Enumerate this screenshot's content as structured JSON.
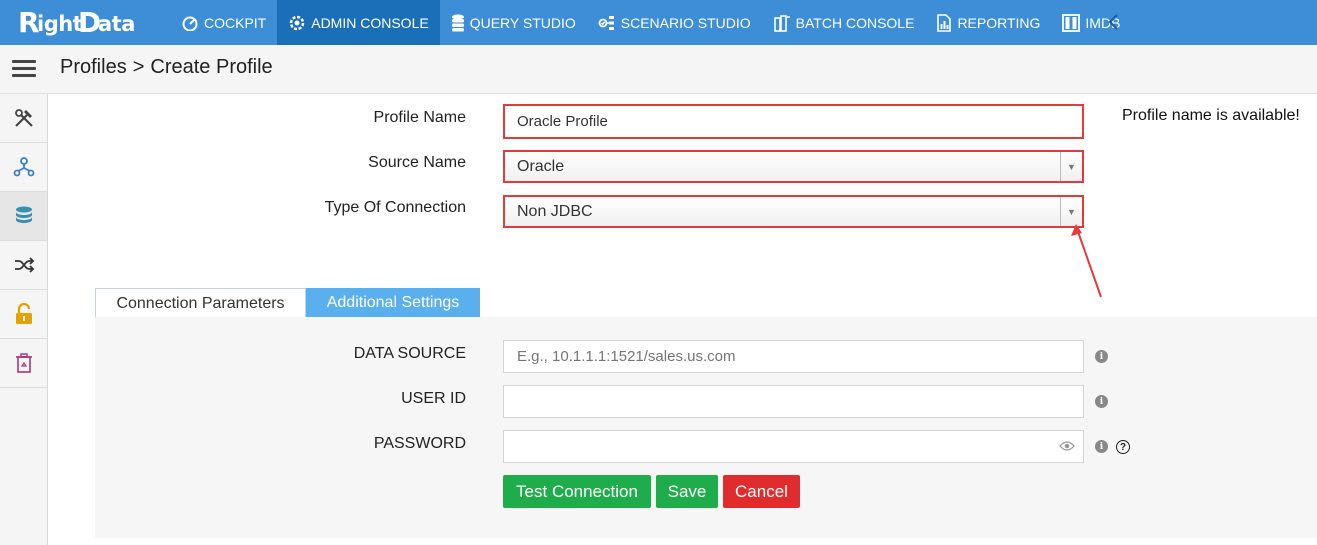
{
  "brand": {
    "logo_text": "RightData"
  },
  "nav": {
    "items": [
      {
        "label": "COCKPIT",
        "icon": "gauge-icon",
        "active": false
      },
      {
        "label": "ADMIN CONSOLE",
        "icon": "gear-icon",
        "active": true
      },
      {
        "label": "QUERY STUDIO",
        "icon": "database-icon",
        "active": false
      },
      {
        "label": "SCENARIO STUDIO",
        "icon": "flow-icon",
        "active": false
      },
      {
        "label": "BATCH CONSOLE",
        "icon": "batch-icon",
        "active": false
      },
      {
        "label": "REPORTING",
        "icon": "report-icon",
        "active": false
      },
      {
        "label": "IMDB",
        "icon": "columns-icon",
        "active": false
      }
    ]
  },
  "breadcrumb": {
    "parent": "Profiles",
    "separator": ">",
    "current": "Create Profile"
  },
  "sidebar": {
    "items": [
      {
        "icon": "tools-icon"
      },
      {
        "icon": "network-icon"
      },
      {
        "icon": "database-icon",
        "active": true
      },
      {
        "icon": "shuffle-icon"
      },
      {
        "icon": "unlock-icon"
      },
      {
        "icon": "recycle-bin-icon"
      }
    ]
  },
  "form": {
    "profile_name_label": "Profile Name",
    "profile_name_value": "Oracle Profile",
    "profile_status": "Profile name is available!",
    "source_name_label": "Source Name",
    "source_name_value": "Oracle",
    "connection_type_label": "Type Of Connection",
    "connection_type_value": "Non JDBC"
  },
  "tabs": {
    "connection_parameters": "Connection Parameters",
    "additional_settings": "Additional Settings"
  },
  "params": {
    "data_source_label": "DATA SOURCE",
    "data_source_placeholder": "E.g., 10.1.1.1:1521/sales.us.com",
    "user_id_label": "USER ID",
    "user_id_value": "",
    "password_label": "PASSWORD",
    "password_value": ""
  },
  "buttons": {
    "test_connection": "Test Connection",
    "save": "Save",
    "cancel": "Cancel"
  },
  "colors": {
    "topbar": "#3d8ed6",
    "nav_active": "#1b6fb9",
    "highlight": "#e33b3b",
    "success": "#1fad4b",
    "danger": "#e02c2c",
    "tab_active": "#5ab0ee"
  }
}
